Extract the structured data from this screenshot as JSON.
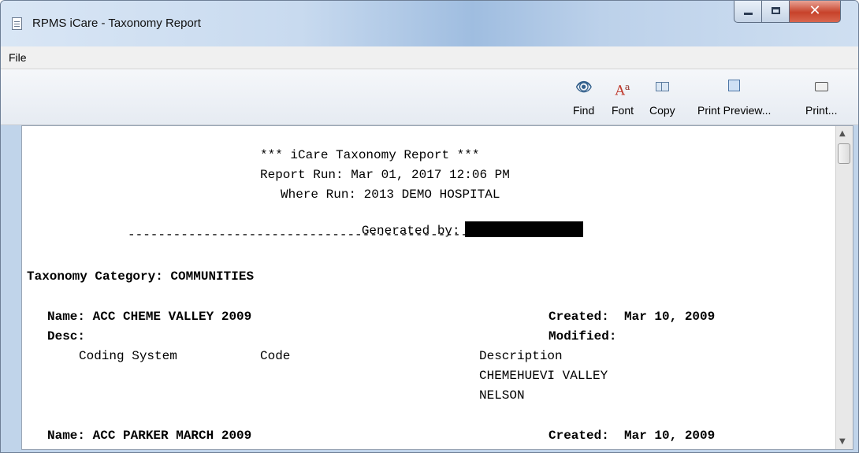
{
  "window": {
    "title": "RPMS iCare - Taxonomy Report",
    "close_glyph": "✕"
  },
  "menu": {
    "file_label": "File"
  },
  "toolbar": {
    "find": {
      "label": "Find",
      "icon": "binoculars-icon"
    },
    "font": {
      "label": "Font",
      "icon": "font-icon"
    },
    "copy": {
      "label": "Copy",
      "icon": "copy-icon"
    },
    "print_preview": {
      "label": "Print Preview...",
      "icon": "print-preview-icon"
    },
    "print": {
      "label": "Print...",
      "icon": "printer-icon"
    }
  },
  "report": {
    "header_title": "*** iCare Taxonomy Report ***",
    "report_run": "Report Run: Mar 01, 2017 12:06 PM",
    "where_run": "Where Run: 2013 DEMO HOSPITAL",
    "generated_by": "Generated by:",
    "separator": "--------------------------------------------------------",
    "category": "Taxonomy Category: COMMUNITIES",
    "entries": [
      {
        "name": "Name: ACC CHEME VALLEY 2009",
        "created": "Created:  Mar 10, 2009",
        "desc": "Desc:",
        "modified": "Modified:",
        "col_coding_system": "Coding System",
        "col_code": "Code",
        "col_description": "Description",
        "descriptions": [
          "CHEMEHUEVI VALLEY",
          "NELSON"
        ]
      },
      {
        "name": "Name: ACC PARKER MARCH 2009",
        "created": "Created:  Mar 10, 2009"
      }
    ]
  }
}
